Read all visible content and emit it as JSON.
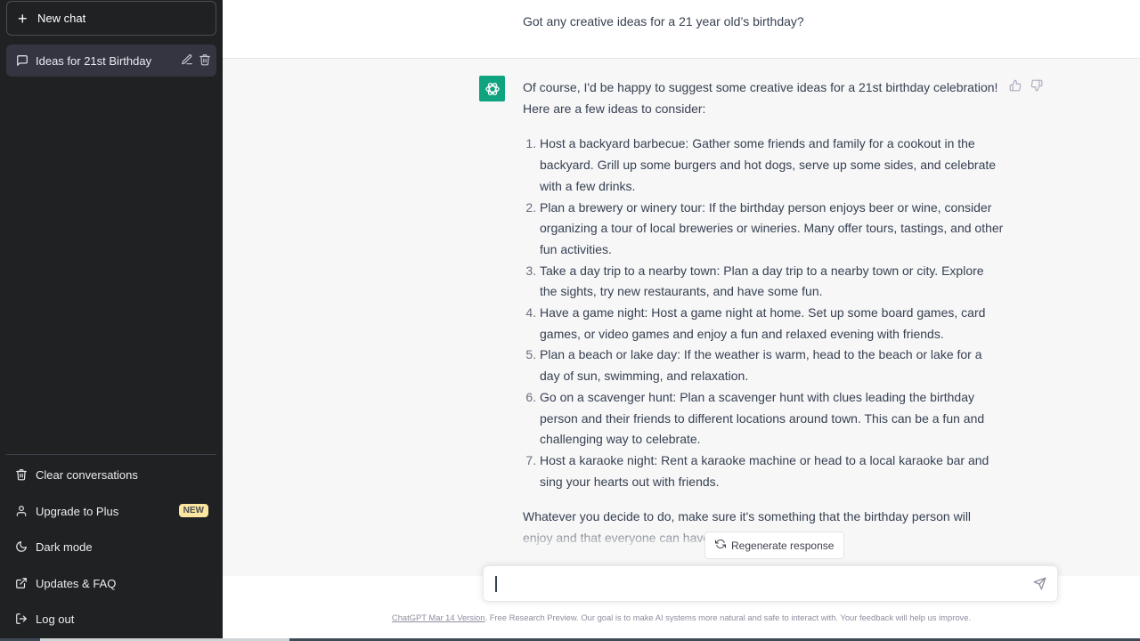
{
  "sidebar": {
    "new_chat_label": "New chat",
    "conversations": [
      {
        "title": "Ideas for 21st Birthday",
        "active": true
      }
    ],
    "menu": [
      {
        "label": "Clear conversations",
        "icon": "trash-icon"
      },
      {
        "label": "Upgrade to Plus",
        "icon": "user-icon",
        "badge": "NEW"
      },
      {
        "label": "Dark mode",
        "icon": "moon-icon"
      },
      {
        "label": "Updates & FAQ",
        "icon": "external-link-icon"
      },
      {
        "label": "Log out",
        "icon": "logout-icon"
      }
    ]
  },
  "conversation": {
    "user_message": "Got any creative ideas for a 21 year old’s birthday?",
    "assistant": {
      "intro": "Of course, I'd be happy to suggest some creative ideas for a 21st birthday celebration! Here are a few ideas to consider:",
      "items": [
        "Host a backyard barbecue: Gather some friends and family for a cookout in the backyard. Grill up some burgers and hot dogs, serve up some sides, and celebrate with a few drinks.",
        "Plan a brewery or winery tour: If the birthday person enjoys beer or wine, consider organizing a tour of local breweries or wineries. Many offer tours, tastings, and other fun activities.",
        "Take a day trip to a nearby town: Plan a day trip to a nearby town or city. Explore the sights, try new restaurants, and have some fun.",
        "Have a game night: Host a game night at home. Set up some board games, card games, or video games and enjoy a fun and relaxed evening with friends.",
        "Plan a beach or lake day: If the weather is warm, head to the beach or lake for a day of sun, swimming, and relaxation.",
        "Go on a scavenger hunt: Plan a scavenger hunt with clues leading the birthday person and their friends to different locations around town. This can be a fun and challenging way to celebrate.",
        "Host a karaoke night: Rent a karaoke machine or head to a local karaoke bar and sing your hearts out with friends."
      ],
      "outro": "Whatever you decide to do, make sure it's something that the birthday person will enjoy and that everyone can have fun with."
    }
  },
  "composer": {
    "regenerate_label": "Regenerate response",
    "input_value": "",
    "input_placeholder": ""
  },
  "footer": {
    "version_link": "ChatGPT Mar 14 Version",
    "text": ". Free Research Preview. Our goal is to make AI systems more natural and safe to interact with. Your feedback will help us improve."
  },
  "colors": {
    "sidebar_bg": "#202123",
    "accent": "#10a37f",
    "badge_bg": "#fae69e"
  }
}
